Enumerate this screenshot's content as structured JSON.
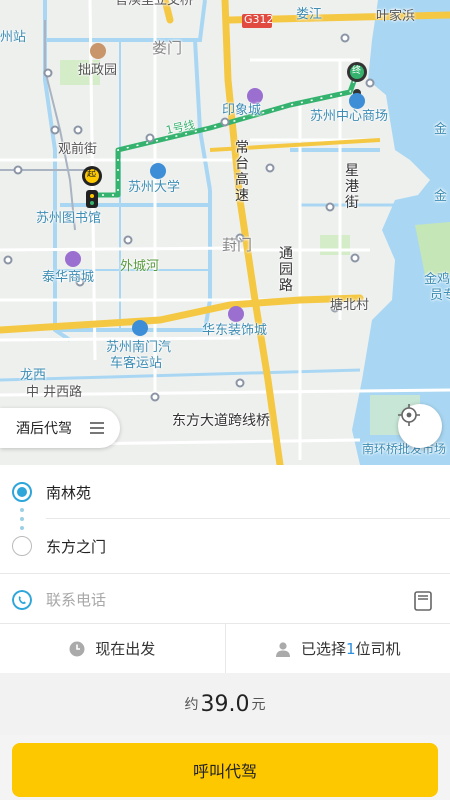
{
  "map": {
    "labels": {
      "top_partial": "官渎里立交桥",
      "suzhou_station": "州站",
      "zhuozheng_garden": "拙政园",
      "loumen": "娄门",
      "loujiang": "娄江",
      "yejiabang": "叶家浜",
      "g312": "G312",
      "guanqian": "观前街",
      "yinxiang_city": "印象城",
      "suzhou_center": "苏州中心商场",
      "suzhou_library": "苏州图书馆",
      "suzhou_univ": "苏州大学",
      "changtai_expressway": "常台高速",
      "xinggang_street": "星港街",
      "fengmen": "葑门",
      "taihua_mall": "泰华商城",
      "waicheng_river": "外城河",
      "tongyuan_road": "通园路",
      "tangbei_village": "塘北村",
      "jinji_lake": "金鸡",
      "jinji_lake_2": "员专",
      "jin_partial": "金",
      "jin_partial_2": "金",
      "huadong_deco": "华东装饰城",
      "nanmen_bus": "苏州南门汽",
      "nanmen_bus_2": "车客运站",
      "longxi": "龙西",
      "longxi_road": "中 井西路",
      "dongfang_bridge": "东方大道跨线桥",
      "nanhuan_market": "南环桥批发市场",
      "metro_line": "1号线",
      "start_badge": "起",
      "end_badge": "终"
    },
    "service_label": "酒后代驾",
    "service_icon": "list-icon",
    "locate_icon": "crosshair-icon"
  },
  "trip": {
    "origin": "南林苑",
    "destination": "东方之门",
    "phone_placeholder": "联系电话"
  },
  "options": {
    "depart_time": "现在出发",
    "driver_prefix": "已选择",
    "driver_count": "1",
    "driver_suffix": "位司机"
  },
  "price": {
    "prefix": "约",
    "amount": "39.0",
    "unit": "元"
  },
  "call_button": "呼叫代驾",
  "colors": {
    "accent_yellow": "#fdc800",
    "accent_blue": "#2b8fde",
    "route_green": "#35b36e",
    "water": "#a9d7f3"
  }
}
